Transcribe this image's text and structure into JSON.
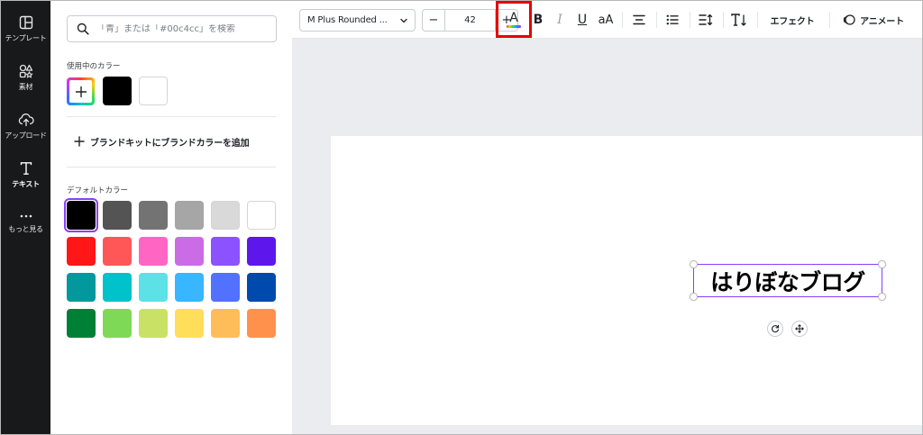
{
  "sidebar": {
    "items": [
      {
        "label": "テンプレート",
        "icon": "template-icon"
      },
      {
        "label": "素材",
        "icon": "elements-icon"
      },
      {
        "label": "アップロード",
        "icon": "upload-icon"
      },
      {
        "label": "テキスト",
        "icon": "text-icon",
        "active": true
      },
      {
        "label": "もっと見る",
        "icon": "more-icon"
      }
    ]
  },
  "color_panel": {
    "search_placeholder": "「青」または「#00c4cc」を検索",
    "used_colors_title": "使用中のカラー",
    "used_colors": [
      "#000000",
      "#ffffff"
    ],
    "brand_kit_label": "ブランドキットにブランドカラーを追加",
    "default_colors_title": "デフォルトカラー",
    "default_colors": [
      [
        "#000000",
        "#545454",
        "#737373",
        "#a6a6a6",
        "#d9d9d9",
        "#ffffff"
      ],
      [
        "#ff1616",
        "#ff5757",
        "#ff66c4",
        "#cb6ce6",
        "#8c52ff",
        "#5e17eb"
      ],
      [
        "#03989e",
        "#00c2cb",
        "#5ce1e6",
        "#38b6ff",
        "#5271ff",
        "#004aad"
      ],
      [
        "#008037",
        "#7ed957",
        "#c9e265",
        "#ffde59",
        "#ffbd59",
        "#ff914d"
      ]
    ],
    "selected_default": "#000000"
  },
  "toolbar": {
    "font_name": "M Plus Rounded ...",
    "font_size": "42",
    "minus": "−",
    "plus": "+",
    "text_color_letter": "A",
    "bold": "B",
    "italic": "I",
    "underline": "U",
    "case": "aA",
    "effects_label": "エフェクト",
    "animate_label": "アニメート"
  },
  "canvas": {
    "text": "はりぼなブログ",
    "text_color": "#000000",
    "selection_color": "#8b3dff"
  },
  "colors": {
    "accent": "#8b3dff",
    "highlight": "#e60000",
    "rail_bg": "#18191b"
  }
}
